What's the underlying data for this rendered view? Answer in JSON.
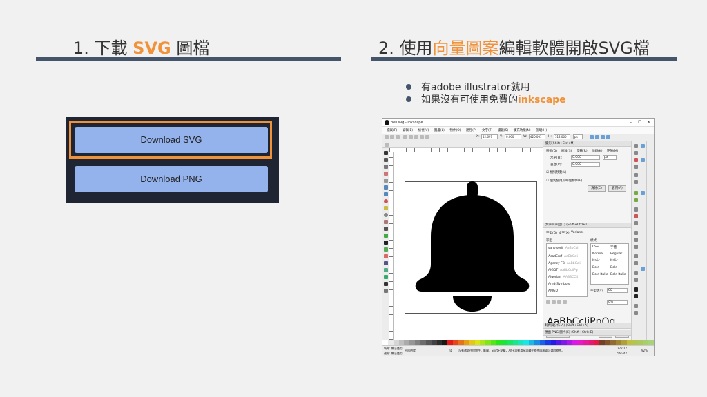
{
  "left_section": {
    "title_prefix": "1. 下載 ",
    "title_accent": "SVG",
    "title_suffix": " 圖檔",
    "buttons": {
      "download_svg": "Download SVG",
      "download_png": "Download PNG"
    }
  },
  "right_section": {
    "title_prefix": "2. 使用",
    "title_accent": "向量圖案",
    "title_suffix": "編輯軟體開啟SVG檔",
    "bullets": [
      {
        "text": "有adobe illustrator就用",
        "accent": ""
      },
      {
        "text": "如果沒有可使用免費的",
        "accent": "inkscape"
      }
    ]
  },
  "inkscape": {
    "window_title": "bell.svg - Inkscape",
    "menu": [
      "檔案(F)",
      "編輯(E)",
      "檢視(V)",
      "圖層(L)",
      "物件(O)",
      "路徑(P)",
      "文字(T)",
      "濾鏡(S)",
      "擴充功能(N)",
      "說明(H)"
    ],
    "toolbar": {
      "x_label": "X:",
      "x_value": "42.697",
      "y_label": "Y:",
      "y_value": "0.000",
      "w_label": "W:",
      "w_value": "420.001",
      "h_label": "H:",
      "h_value": "512.000",
      "unit": "px"
    },
    "fill_stroke_panel": {
      "title": "變形(Shift+Ctrl+M)",
      "tabs": [
        "移動(Q)",
        "縮放(S)",
        "旋轉(R)",
        "傾斜(K)",
        "矩陣(M)"
      ],
      "horizontal_label": "水平(H):",
      "horizontal_value": "0.000",
      "vertical_label": "垂直(V):",
      "vertical_value": "0.000",
      "unit": "px",
      "relative_move": "相對移動(L)",
      "apply_separately": "個別套用於每個物件(E)",
      "clear_button": "清除(C)",
      "apply_button": "套用(A)"
    },
    "text_font_panel": {
      "title": "文字與字型(T) (Shift+Ctrl+T)",
      "tabs": [
        "字型(O)",
        "文字(X)",
        "Variants"
      ],
      "font_family_header": "字型",
      "style_header": "樣式",
      "fonts": [
        {
          "name": "sans-serif",
          "preview": "AaBbCcIi"
        },
        {
          "name": "AcadEref",
          "preview": "AaBbCcIi"
        },
        {
          "name": "Agency FB",
          "preview": "AaBbCcIi"
        },
        {
          "name": "AIGDT",
          "preview": "AaBbCcIiPp"
        },
        {
          "name": "Algerian",
          "preview": "AABBCCII"
        },
        {
          "name": "AmdtSymbols",
          "preview": ""
        },
        {
          "name": "AMGDT",
          "preview": ""
        }
      ],
      "styles_css": [
        "CSS",
        "Normal",
        "Italic",
        "Bold",
        "Bold Italic"
      ],
      "styles_face": [
        "字體",
        "Regular",
        "Italic",
        "Bold",
        "Bold Italic"
      ],
      "font_size_label": "字型大小:",
      "font_size_value": "60",
      "spacing_value": "0%",
      "preview_text": "AaBbCcIiPpQq...",
      "set_default": "設定為預設值",
      "apply": "套用(A)",
      "close": "關閉(C)"
    },
    "collapsed_panels": [
      "對齊與分佈(A) (Shift+Ctrl+A)",
      "匯出 PNG 圖片(E) (Shift+Ctrl+E)"
    ],
    "status": {
      "fill_label": "填充:",
      "fill_value": "無法使用",
      "stroke_label": "邊框:",
      "stroke_value": "無法使用",
      "opacity_label": "不透明度:",
      "layer": "nb",
      "message": "沒有選取任何物件。點擊，Shift+點擊，Alt+滾動滑鼠滾輪在物件四周或可選取物件。",
      "x_coord": "272.27",
      "y_coord": "565.42",
      "zoom": "92%"
    }
  },
  "colors": {
    "accent": "#f0923a",
    "heading_rule": "#44546a",
    "button_fill": "#94b2ec",
    "panel_dark": "#1f2533"
  }
}
